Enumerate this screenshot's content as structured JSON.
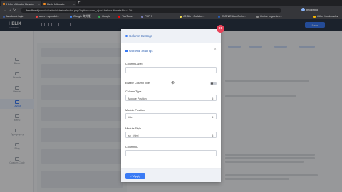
{
  "browser": {
    "tabs": [
      {
        "label": "Helix Ultimate Header"
      },
      {
        "label": "Helix Ultimate"
      }
    ],
    "url_host": "localhost",
    "url_path": "/joomla4/administrator/index.php?option=com_ajax&helix=ultimate&id=13#",
    "incognito_label": "Incognito",
    "bookmarks": [
      {
        "label": "facebook login",
        "color": "#3b5998"
      },
      {
        "label": "ubex - appsdot...",
        "color": "#e44"
      },
      {
        "label": "Google 海外版",
        "color": "#4285f4"
      },
      {
        "label": "Google",
        "color": "#34a853"
      },
      {
        "label": "YouTube",
        "color": "#ff0000"
      },
      {
        "label": "PHP 7",
        "color": "#777bb3"
      },
      {
        "label": "JS Bin - Collabo...",
        "color": "#f0db4f"
      },
      {
        "label": "JSON Editor Onlin...",
        "color": "#2a5db0"
      },
      {
        "label": "Online regex tes...",
        "color": "#888"
      },
      {
        "label": "Other bookmarks",
        "color": "#f5b400"
      }
    ]
  },
  "admin": {
    "brand": "HELIX",
    "brand_sub": "ULTIMATE",
    "save_label": "Save"
  },
  "sidebar": {
    "items": [
      {
        "label": "Basic"
      },
      {
        "label": "Presets"
      },
      {
        "label": "Header"
      },
      {
        "label": "Layout"
      },
      {
        "label": "Menu"
      },
      {
        "label": "Typography"
      },
      {
        "label": "Blog"
      },
      {
        "label": "Custom Code"
      }
    ]
  },
  "modal": {
    "title": "Column Settings",
    "section_title": "General Settings",
    "fields": {
      "column_label": {
        "label": "Column Label",
        "value": ""
      },
      "enable_title": {
        "label": "Enable Column Title",
        "on": false
      },
      "column_type": {
        "label": "Column Type",
        "value": "Module Position"
      },
      "module_position": {
        "label": "Module Position",
        "value": "title"
      },
      "module_style": {
        "label": "Module Style",
        "value": "sp_xhtml"
      },
      "column_id": {
        "label": "Column ID",
        "value": ""
      }
    },
    "apply_label": "Apply"
  }
}
